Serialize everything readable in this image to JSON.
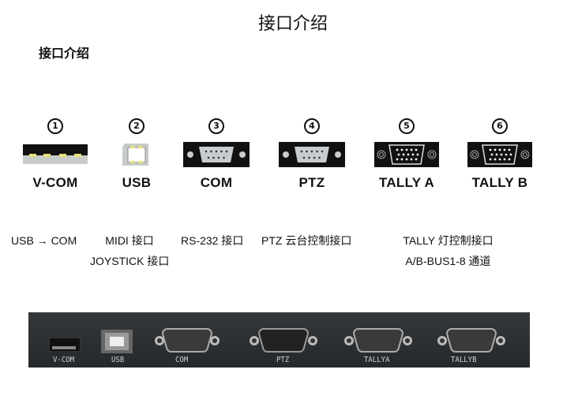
{
  "page": {
    "title": "接口介绍",
    "subtitle": "接口介绍"
  },
  "ports": [
    {
      "number": "1",
      "name": "V-COM",
      "icon": "usb-a-port-icon"
    },
    {
      "number": "2",
      "name": "USB",
      "icon": "usb-b-port-icon"
    },
    {
      "number": "3",
      "name": "COM",
      "icon": "db9-port-icon"
    },
    {
      "number": "4",
      "name": "PTZ",
      "icon": "db9-port-icon"
    },
    {
      "number": "5",
      "name": "TALLY A",
      "icon": "db15-port-icon"
    },
    {
      "number": "6",
      "name": "TALLY B",
      "icon": "db15-port-icon"
    }
  ],
  "descriptions": {
    "vcom": "USB → COM",
    "usb_line1": "MIDI 接口",
    "usb_line2": "JOYSTICK 接口",
    "com": "RS-232 接口",
    "ptz": "PTZ 云台控制接口",
    "tally_line1": "TALLY  灯控制接口",
    "tally_line2": "A/B-BUS1-8 通道"
  },
  "panel_labels": {
    "vcom": "V-COM",
    "usb": "USB",
    "com": "COM",
    "ptz": "PTZ",
    "tallya": "TALLYA",
    "tallyb": "TALLYB"
  }
}
